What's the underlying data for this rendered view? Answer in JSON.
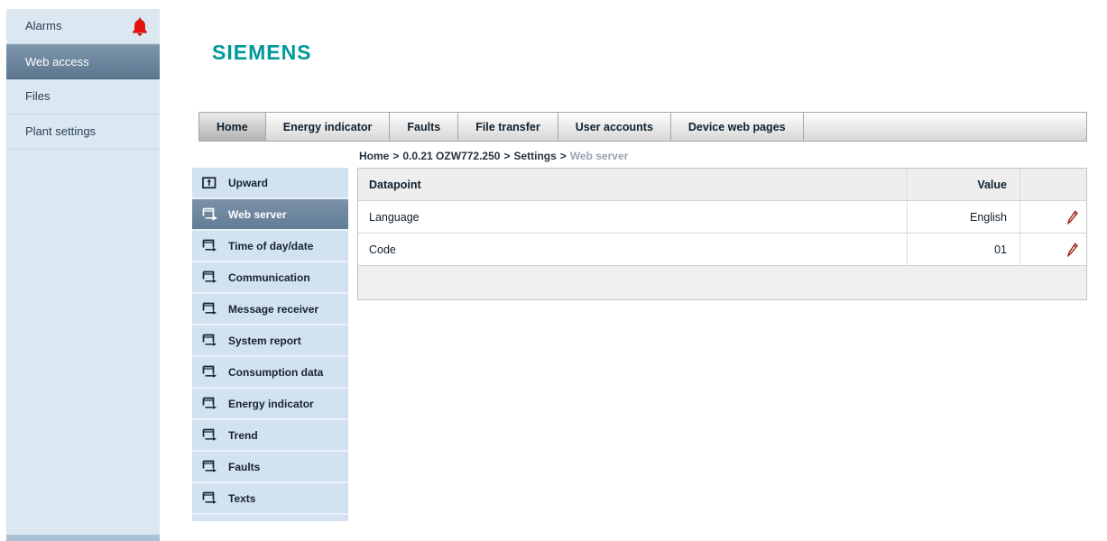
{
  "brand": {
    "logo_text": "SIEMENS",
    "logo_color": "#009999"
  },
  "sidebar": {
    "items": [
      {
        "label": "Alarms",
        "selected": false,
        "alarm_icon": "bell-icon"
      },
      {
        "label": "Web access",
        "selected": true
      },
      {
        "label": "Files",
        "selected": false
      },
      {
        "label": "Plant settings",
        "selected": false
      }
    ]
  },
  "tabs": [
    {
      "label": "Home",
      "active": true
    },
    {
      "label": "Energy indicator",
      "active": false
    },
    {
      "label": "Faults",
      "active": false
    },
    {
      "label": "File transfer",
      "active": false
    },
    {
      "label": "User accounts",
      "active": false
    },
    {
      "label": "Device web pages",
      "active": false
    }
  ],
  "breadcrumb": {
    "separator": ">",
    "segments": [
      "Home",
      "0.0.21 OZW772.250",
      "Settings",
      "Web server"
    ],
    "current": "Web server"
  },
  "menu": {
    "items": [
      {
        "label": "Upward",
        "icon": "upward-icon",
        "selected": false
      },
      {
        "label": "Web server",
        "icon": "page-enter-icon",
        "selected": true
      },
      {
        "label": "Time of day/date",
        "icon": "page-enter-icon",
        "selected": false
      },
      {
        "label": "Communication",
        "icon": "page-enter-icon",
        "selected": false
      },
      {
        "label": "Message receiver",
        "icon": "page-enter-icon",
        "selected": false
      },
      {
        "label": "System report",
        "icon": "page-enter-icon",
        "selected": false
      },
      {
        "label": "Consumption data",
        "icon": "page-enter-icon",
        "selected": false
      },
      {
        "label": "Energy indicator",
        "icon": "page-enter-icon",
        "selected": false
      },
      {
        "label": "Trend",
        "icon": "page-enter-icon",
        "selected": false
      },
      {
        "label": "Faults",
        "icon": "page-enter-icon",
        "selected": false
      },
      {
        "label": "Texts",
        "icon": "page-enter-icon",
        "selected": false
      }
    ]
  },
  "datapoint_table": {
    "headers": {
      "datapoint": "Datapoint",
      "value": "Value"
    },
    "rows": [
      {
        "datapoint": "Language",
        "value": "English",
        "edit_icon": "pencil-icon"
      },
      {
        "datapoint": "Code",
        "value": "01",
        "edit_icon": "pencil-icon"
      }
    ]
  },
  "colors": {
    "accent_teal": "#009999",
    "sidebar_bg": "#dbe7f1",
    "menu_bg": "#d2e2f0",
    "selected_slate": "#627c96",
    "alarm_red": "#e8110b",
    "edit_red": "#9b1209"
  }
}
